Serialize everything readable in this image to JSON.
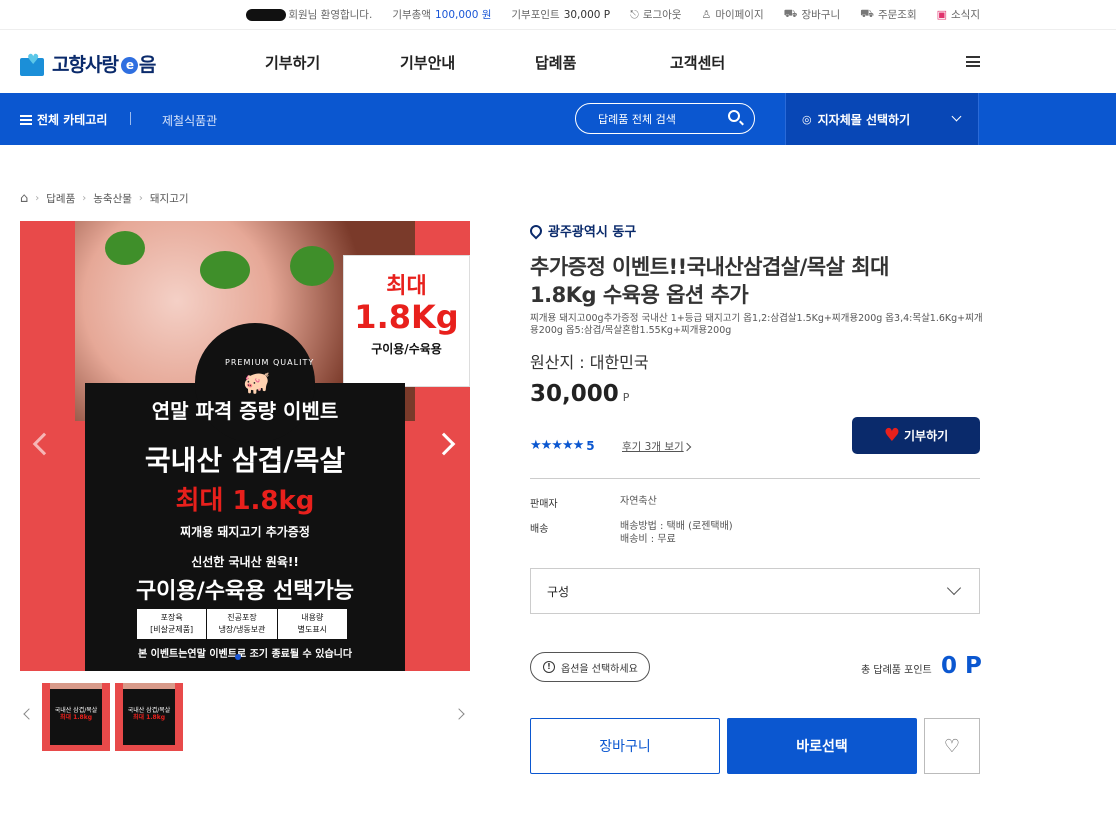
{
  "topbar": {
    "welcome": "회원님 환영합니다.",
    "donate_total_label": "기부총액",
    "donate_total_value": "100,000 원",
    "donate_point_label": "기부포인트",
    "donate_point_value": "30,000 P",
    "logout": "로그아웃",
    "mypage": "마이페이지",
    "cart": "장바구니",
    "orders": "주문조회",
    "news": "소식지"
  },
  "header": {
    "logo_text_1": "고향사랑",
    "logo_e": "e",
    "logo_text_2": "음",
    "nav": [
      "기부하기",
      "기부안내",
      "답례품",
      "고객센터"
    ]
  },
  "bluebar": {
    "all_category": "전체 카테고리",
    "shop": "제철식품관",
    "search_placeholder": "답례품 전체 검색",
    "region_select": "지자체몰 선택하기"
  },
  "breadcrumb": [
    "답례품",
    "농축산물",
    "돼지고기"
  ],
  "image": {
    "badge_top": "최대",
    "badge_main": "1.8Kg",
    "badge_sub": "구이용/수육용",
    "premium": "PREMIUM QUALITY",
    "line1": "연말 파격 증량 이벤트",
    "line2": "국내산 삼겹/목살",
    "line3": "최대 1.8kg",
    "line4": "찌개용 돼지고기 추가증정",
    "line5": "신선한 국내산 원육!!",
    "line6": "구이용/수육용 선택가능",
    "box1": "포장육\n[비살균제품]",
    "box2": "진공포장\n냉장/냉동보관",
    "box3": "내용량\n별도표시",
    "note": "본 이벤트는연말 이벤트로 조기 종료될 수 있습니다"
  },
  "product": {
    "location": "광주광역시 동구",
    "title": "추가증정 이벤트!!국내산삼겹살/목살 최대 1.8Kg 수육용 옵션 추가",
    "description": "찌개용 돼지고00g추가증정 국내산 1+등급 돼지고기 옵1,2:삼겹살1.5Kg+찌개용200g 옵3,4:목살1.6Kg+찌개용200g 옵5:삼겹/목살혼합1.55Kg+찌개용200g",
    "origin": "원산지 : 대한민국",
    "price": "30,000",
    "price_unit": "P",
    "stars": "★★★★★",
    "rating": "5",
    "review_link": "후기 3개 보기",
    "donate_button": "기부하기",
    "seller_label": "판매자",
    "seller_value": "자연축산",
    "shipping_label": "배송",
    "shipping_method": "배송방법 : 택배 (로젠택배)",
    "shipping_fee": "배송비 : 무료",
    "option_select": "구성",
    "option_message": "옵션을 선택하세요",
    "total_label": "총 답례품 포인트",
    "total_value": "0 P",
    "cart_button": "장바구니",
    "buy_button": "바로선택",
    "wish_icon": "heart-outline-icon"
  },
  "colors": {
    "primary": "#0b57d0",
    "navy": "#0a2a6b",
    "image_bg": "#e84a4a"
  }
}
